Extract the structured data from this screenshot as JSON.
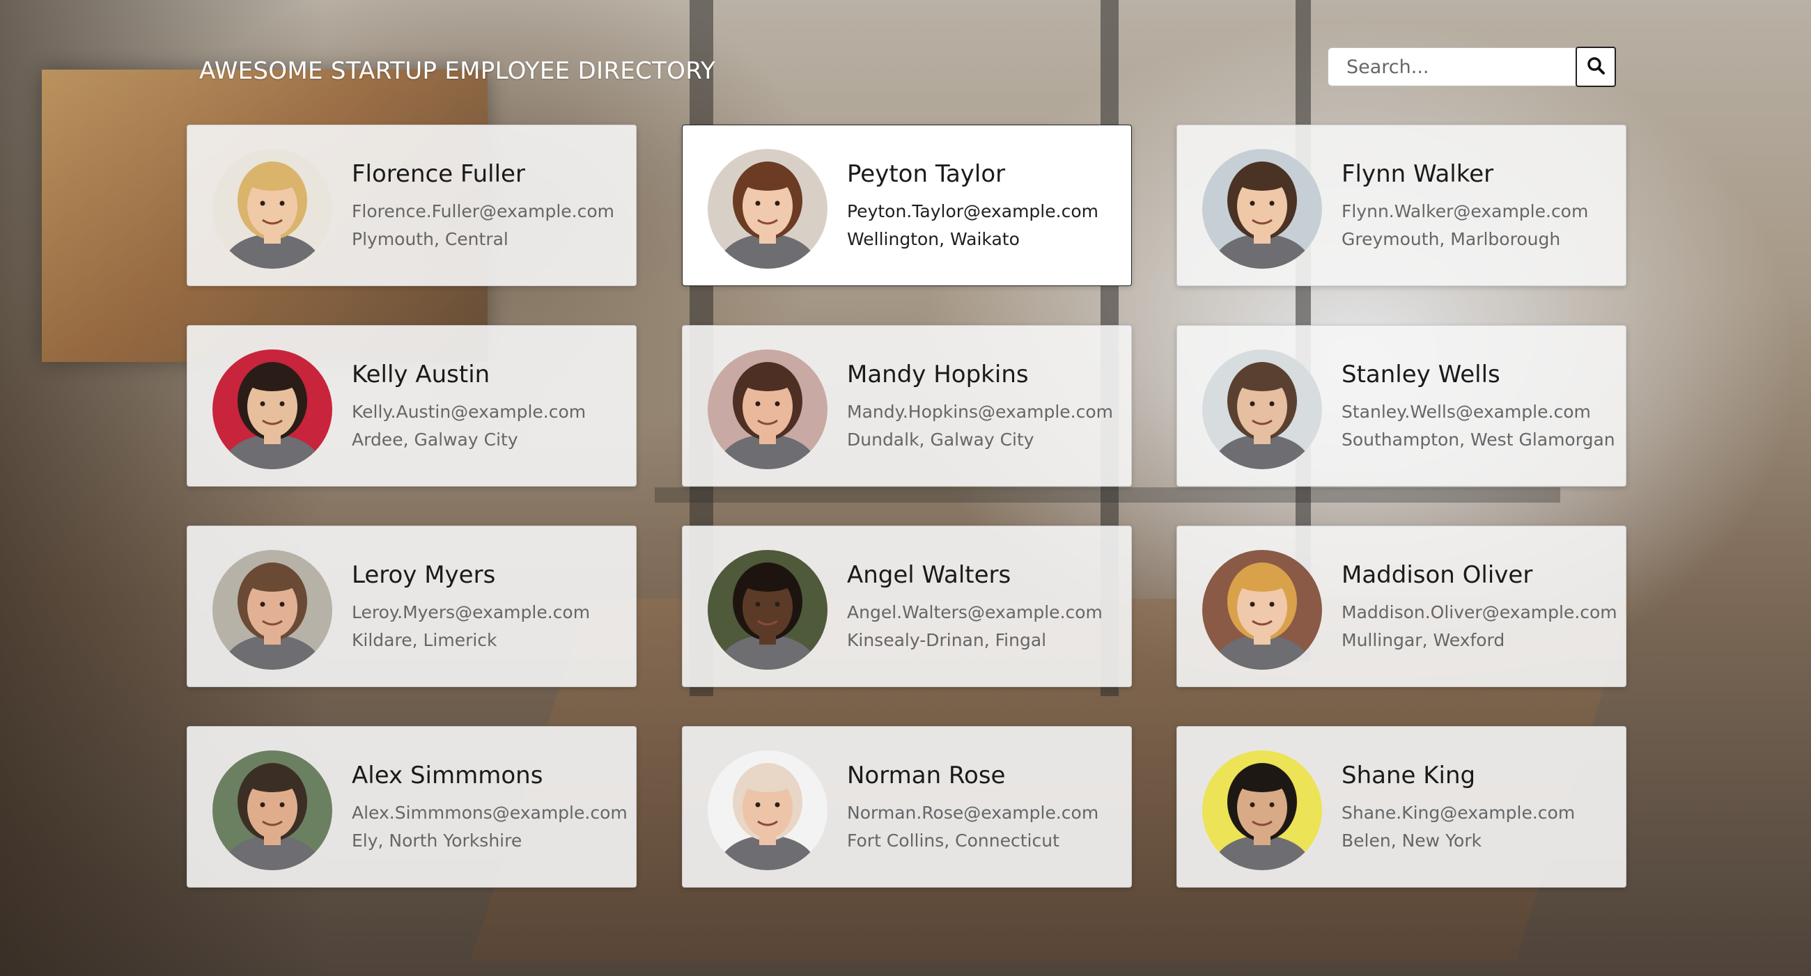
{
  "header": {
    "title": "AWESOME STARTUP EMPLOYEE DIRECTORY",
    "search_placeholder": "Search...",
    "search_icon": "search-icon"
  },
  "employees": [
    {
      "name": "Florence Fuller",
      "email": "Florence.Fuller@example.com",
      "location": "Plymouth, Central",
      "skin": "#f0c9a6",
      "hair": "#d9b46a",
      "bg": "#e9e4dc",
      "selected": false
    },
    {
      "name": "Peyton Taylor",
      "email": "Peyton.Taylor@example.com",
      "location": "Wellington, Waikato",
      "skin": "#f1c9ad",
      "hair": "#6b3b24",
      "bg": "#d8d0c6",
      "selected": true
    },
    {
      "name": "Flynn Walker",
      "email": "Flynn.Walker@example.com",
      "location": "Greymouth, Marlborough",
      "skin": "#efc8a8",
      "hair": "#4a3325",
      "bg": "#c7cfd6",
      "selected": false
    },
    {
      "name": "Kelly Austin",
      "email": "Kelly.Austin@example.com",
      "location": "Ardee, Galway City",
      "skin": "#e8bf9c",
      "hair": "#2a1d18",
      "bg": "#c8243b",
      "selected": false
    },
    {
      "name": "Mandy Hopkins",
      "email": "Mandy.Hopkins@example.com",
      "location": "Dundalk, Galway City",
      "skin": "#eab99c",
      "hair": "#4d2f24",
      "bg": "#c9a9a4",
      "selected": false
    },
    {
      "name": "Stanley Wells",
      "email": "Stanley.Wells@example.com",
      "location": "Southampton, West Glamorgan",
      "skin": "#e5bfa0",
      "hair": "#5a4030",
      "bg": "#d7dcdf",
      "selected": false
    },
    {
      "name": "Leroy Myers",
      "email": "Leroy.Myers@example.com",
      "location": "Kildare, Limerick",
      "skin": "#e2b193",
      "hair": "#6a4a35",
      "bg": "#b7b2a8",
      "selected": false
    },
    {
      "name": "Angel Walters",
      "email": "Angel.Walters@example.com",
      "location": "Kinsealy-Drinan, Fingal",
      "skin": "#5b3b28",
      "hair": "#1d1410",
      "bg": "#4e5a3a",
      "selected": false
    },
    {
      "name": "Maddison Oliver",
      "email": "Maddison.Oliver@example.com",
      "location": "Mullingar, Wexford",
      "skin": "#f0c8aa",
      "hair": "#d9a14a",
      "bg": "#8a5a46",
      "selected": false
    },
    {
      "name": "Alex Simmmons",
      "email": "Alex.Simmmons@example.com",
      "location": "Ely, North Yorkshire",
      "skin": "#e0ad8c",
      "hair": "#3b2f25",
      "bg": "#6b8060",
      "selected": false
    },
    {
      "name": "Norman Rose",
      "email": "Norman.Rose@example.com",
      "location": "Fort Collins, Connecticut",
      "skin": "#edc4a8",
      "hair": "#e8d6c6",
      "bg": "#f3f3f3",
      "selected": false
    },
    {
      "name": "Shane King",
      "email": "Shane.King@example.com",
      "location": "Belen, New York",
      "skin": "#d8ab86",
      "hair": "#1e1814",
      "bg": "#ece356",
      "selected": false
    }
  ]
}
